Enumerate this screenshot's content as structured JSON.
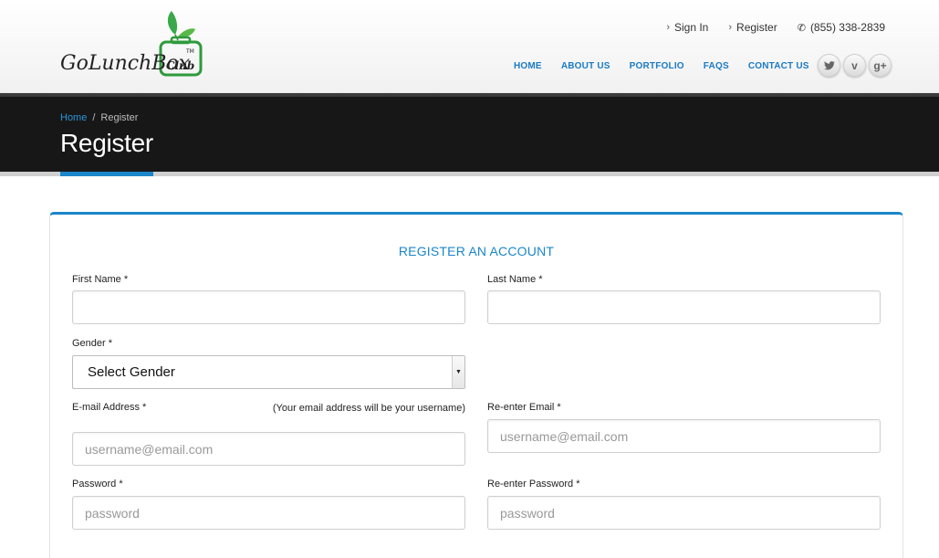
{
  "brand": {
    "logo_text": "GoLunchBox",
    "logo_subtext": "Club",
    "logo_tm": "TM"
  },
  "toplinks": {
    "sign_in": "Sign In",
    "register": "Register",
    "phone": "(855) 338-2839"
  },
  "nav": {
    "items": [
      {
        "label": "HOME"
      },
      {
        "label": "ABOUT US"
      },
      {
        "label": "PORTFOLIO"
      },
      {
        "label": "FAQS"
      },
      {
        "label": "CONTACT US"
      }
    ]
  },
  "social": {
    "twitter": "twitter-icon",
    "vimeo": "v",
    "google_plus": "g+"
  },
  "breadcrumb": {
    "home": "Home",
    "separator": "/",
    "current": "Register"
  },
  "page_title": "Register",
  "form": {
    "title": "REGISTER AN ACCOUNT",
    "first_name_label": "First Name *",
    "last_name_label": "Last Name *",
    "gender_label": "Gender *",
    "gender_selected": "Select Gender",
    "email_label": "E-mail Address *",
    "email_note": "(Your email address will be your username)",
    "email_placeholder": "username@email.com",
    "reemail_label": "Re-enter Email *",
    "reemail_placeholder": "username@email.com",
    "password_label": "Password *",
    "password_placeholder": "password",
    "repassword_label": "Re-enter Password *",
    "repassword_placeholder": "password"
  },
  "colors": {
    "accent": "#1a86c8",
    "band": "#171717",
    "logo_green": "#2e9a3c"
  }
}
